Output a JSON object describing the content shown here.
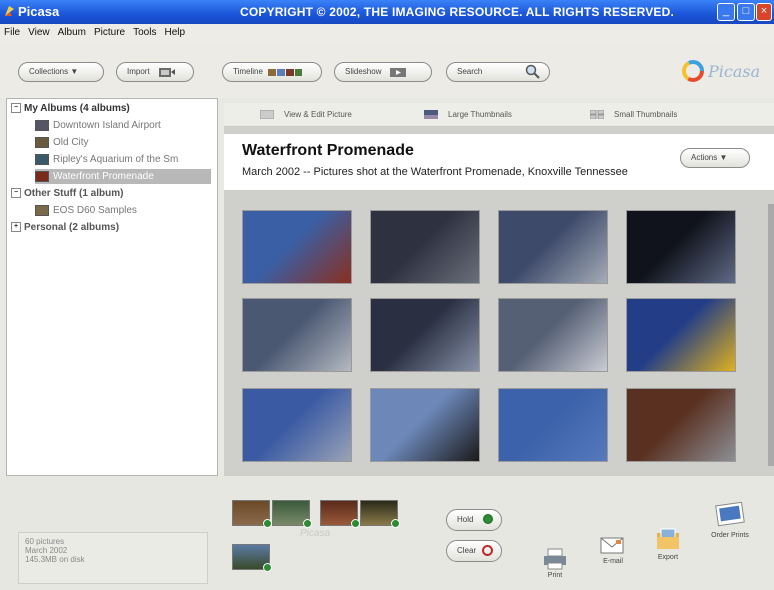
{
  "window": {
    "app_title": "Picasa",
    "copyright": "COPYRIGHT © 2002, THE IMAGING RESOURCE. ALL RIGHTS RESERVED.",
    "controls": [
      "_",
      "□",
      "×"
    ]
  },
  "menu": [
    "File",
    "View",
    "Album",
    "Picture",
    "Tools",
    "Help"
  ],
  "toolbar": {
    "collections": "Collections ▼",
    "import": "Import",
    "timeline": "Timeline",
    "slideshow": "Slideshow",
    "search": "Search",
    "brand": "Picasa"
  },
  "sidebar": {
    "groups": [
      {
        "label": "My Albums (4 albums)",
        "expanded": true,
        "items": [
          "Downtown Island Airport",
          "Old City",
          "Ripley's Aquarium of the Sm",
          "Waterfront Promenade"
        ],
        "selected": "Waterfront Promenade"
      },
      {
        "label": "Other Stuff (1 album)",
        "expanded": true,
        "items": [
          "EOS D60 Samples"
        ]
      },
      {
        "label": "Personal (2 albums)",
        "expanded": false,
        "items": []
      }
    ]
  },
  "view_tabs": [
    "View & Edit Picture",
    "Large Thumbnails",
    "Small Thumbnails"
  ],
  "album": {
    "title": "Waterfront Promenade",
    "description": "March 2002 -- Pictures shot at the Waterfront Promenade, Knoxville Tennessee",
    "actions": "Actions ▼"
  },
  "photos": [
    {
      "name": "red-frame-sky",
      "colors": [
        "#3a5fa4",
        "#8a2f1f"
      ]
    },
    {
      "name": "bear-statue-1",
      "colors": [
        "#2e3240",
        "#6a6f7c"
      ]
    },
    {
      "name": "bear-statue-2",
      "colors": [
        "#3d4a6a",
        "#a5acb8"
      ]
    },
    {
      "name": "bear-closeup",
      "colors": [
        "#10131c",
        "#5f6a86"
      ]
    },
    {
      "name": "bear-statue-3",
      "colors": [
        "#4b5872",
        "#b4b9c2"
      ]
    },
    {
      "name": "bear-texture",
      "colors": [
        "#2a3042",
        "#8791a8"
      ]
    },
    {
      "name": "bear-statue-4",
      "colors": [
        "#566075",
        "#c9ccd3"
      ]
    },
    {
      "name": "yellow-flag",
      "colors": [
        "#233e86",
        "#e0b120"
      ]
    },
    {
      "name": "bird-sculpture",
      "colors": [
        "#3a5aa4",
        "#9aa3b6"
      ]
    },
    {
      "name": "dark-structure",
      "colors": [
        "#6c87b8",
        "#1a1a1a"
      ]
    },
    {
      "name": "blue-sky",
      "colors": [
        "#3b62aa",
        "#5679bb"
      ]
    },
    {
      "name": "red-box",
      "colors": [
        "#5a3020",
        "#8d8f95"
      ]
    }
  ],
  "info": {
    "count": "60 pictures",
    "date": "March 2002",
    "size": "145.3MB on disk"
  },
  "tray": {
    "hold": "Hold",
    "clear": "Clear",
    "watermark": "Picasa"
  },
  "actions": {
    "print": "Print",
    "email": "E-mail",
    "export": "Export",
    "order": "Order Prints"
  },
  "colors": {
    "titlebar": "#1a55d8",
    "selection": "#b8b8b8",
    "hold_dot": "#2e8a35",
    "clear_ring": "#c0282c"
  }
}
